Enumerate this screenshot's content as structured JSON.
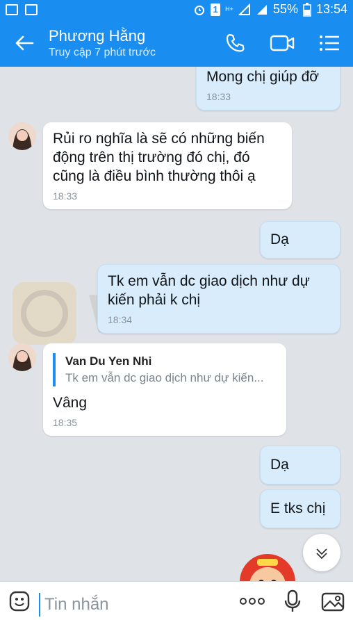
{
  "status_bar": {
    "battery": "55%",
    "time": "13:54",
    "badge": "1",
    "network": "H+"
  },
  "header": {
    "contact_name": "Phương Hằng",
    "last_seen": "Truy cập 7 phút trước"
  },
  "watermark": {
    "text": "WikiFX"
  },
  "messages": [
    {
      "from": "me",
      "text": "Mong chị giúp đỡ",
      "time": "18:33"
    },
    {
      "from": "them",
      "text": "Rủi ro nghĩa là sẽ có những biến động trên thị trường đó chị, đó cũng là điều bình thường thôi ạ",
      "time": "18:33"
    },
    {
      "from": "me",
      "text": "Dạ",
      "time": ""
    },
    {
      "from": "me",
      "text": "Tk em vẫn dc giao dịch như dự kiến phải k chị",
      "time": "18:34"
    },
    {
      "from": "them",
      "quote_name": "Van Du Yen Nhi",
      "quote_text": "Tk em vẫn dc giao dịch như dự kiến...",
      "text": "Vâng",
      "time": "18:35"
    },
    {
      "from": "me",
      "text": "Dạ",
      "time": ""
    },
    {
      "from": "me",
      "text": "E tks chị",
      "time": ""
    }
  ],
  "input": {
    "placeholder": "Tin nhắn"
  },
  "colors": {
    "accent": "#1a8ef0",
    "my_bubble": "#d8ecfb",
    "their_bubble": "#ffffff",
    "background": "#dfe3e8"
  },
  "icons": [
    "back-arrow-icon",
    "phone-icon",
    "video-call-icon",
    "menu-icon",
    "emoji-icon",
    "more-icon",
    "microphone-icon",
    "image-icon",
    "chevron-down-icon"
  ]
}
